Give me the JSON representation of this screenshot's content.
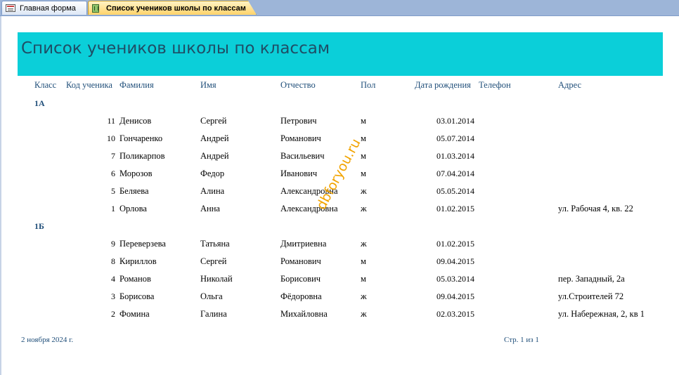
{
  "tabs": [
    {
      "label": "Главная форма",
      "icon": "form-icon"
    },
    {
      "label": "Список учеников школы по классам",
      "icon": "report-icon"
    }
  ],
  "report": {
    "title": "Список учеников школы по классам",
    "columns": [
      "Класс",
      "Код ученика",
      "Фамилия",
      "Имя",
      "Отчество",
      "Пол",
      "Дата рождения",
      "Телефон",
      "Адрес"
    ],
    "groups": [
      {
        "class": "1А",
        "rows": [
          {
            "code": "11",
            "surname": "Денисов",
            "name": "Сергей",
            "patronymic": "Петрович",
            "sex": "м",
            "birth": "03.01.2014",
            "phone": "",
            "address": ""
          },
          {
            "code": "10",
            "surname": "Гончаренко",
            "name": "Андрей",
            "patronymic": "Романович",
            "sex": "м",
            "birth": "05.07.2014",
            "phone": "",
            "address": ""
          },
          {
            "code": "7",
            "surname": "Поликарпов",
            "name": "Андрей",
            "patronymic": "Васильевич",
            "sex": "м",
            "birth": "01.03.2014",
            "phone": "",
            "address": ""
          },
          {
            "code": "6",
            "surname": "Морозов",
            "name": "Федор",
            "patronymic": "Иванович",
            "sex": "м",
            "birth": "07.04.2014",
            "phone": "",
            "address": ""
          },
          {
            "code": "5",
            "surname": "Беляева",
            "name": "Алина",
            "patronymic": "Александровна",
            "sex": "ж",
            "birth": "05.05.2014",
            "phone": "",
            "address": ""
          },
          {
            "code": "1",
            "surname": "Орлова",
            "name": "Анна",
            "patronymic": "Александровна",
            "sex": "ж",
            "birth": "01.02.2015",
            "phone": "",
            "address": "ул. Рабочая 4, кв. 22"
          }
        ]
      },
      {
        "class": "1Б",
        "rows": [
          {
            "code": "9",
            "surname": "Переверзева",
            "name": "Татьяна",
            "patronymic": "Дмитриевна",
            "sex": "ж",
            "birth": "01.02.2015",
            "phone": "",
            "address": ""
          },
          {
            "code": "8",
            "surname": "Кириллов",
            "name": "Сергей",
            "patronymic": "Романович",
            "sex": "м",
            "birth": "09.04.2015",
            "phone": "",
            "address": ""
          },
          {
            "code": "4",
            "surname": "Романов",
            "name": "Николай",
            "patronymic": "Борисович",
            "sex": "м",
            "birth": "05.03.2014",
            "phone": "",
            "address": "пер. Западный, 2а"
          },
          {
            "code": "3",
            "surname": "Борисова",
            "name": "Ольга",
            "patronymic": "Фёдоровна",
            "sex": "ж",
            "birth": "09.04.2015",
            "phone": "",
            "address": "ул.Строителей 72"
          },
          {
            "code": "2",
            "surname": "Фомина",
            "name": "Галина",
            "patronymic": "Михайловна",
            "sex": "ж",
            "birth": "02.03.2015",
            "phone": "",
            "address": "ул. Набережная, 2, кв 1"
          }
        ]
      }
    ],
    "footer": {
      "date": "2 ноября 2024 г.",
      "page": "Стр. 1 из 1"
    }
  },
  "watermark": "dbforyou.ru",
  "colors": {
    "title_band": "#0bcfd9",
    "header_text": "#1f4e79",
    "active_tab": "#ffd36a",
    "watermark": "#f2a400"
  }
}
